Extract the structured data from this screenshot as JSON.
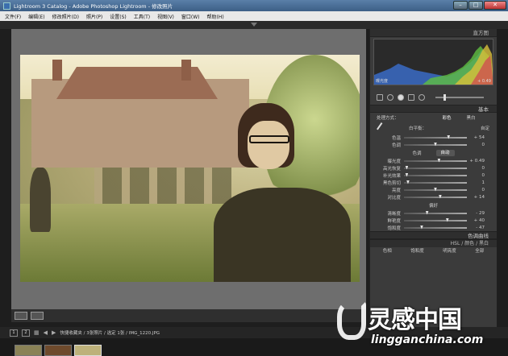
{
  "window": {
    "title": "Lightroom 3 Catalog - Adobe Photoshop Lightroom - 修改照片"
  },
  "menu": [
    "文件(F)",
    "编辑(E)",
    "修改照片(D)",
    "照片(P)",
    "设置(S)",
    "工具(T)",
    "视图(V)",
    "窗口(W)",
    "帮助(H)"
  ],
  "panels": {
    "histogram_title": "直方图",
    "histogram_label": "曝光度",
    "histogram_value": "+ 0.49",
    "basic_title": "基本",
    "treatment_label": "处理方式：",
    "treatment_options": [
      "彩色",
      "黑白"
    ],
    "wb_label": "白平衡：",
    "wb_value": "自定",
    "temp": {
      "name": "色温",
      "value": "+ 54",
      "pos": 0.72
    },
    "tint": {
      "name": "色调",
      "value": "0",
      "pos": 0.5
    },
    "tone_label": "色调",
    "auto_label": "自动",
    "tone_sliders": [
      {
        "name": "曝光度",
        "value": "+ 0.49",
        "pos": 0.56
      },
      {
        "name": "高光恢复",
        "value": "0",
        "pos": 0.02
      },
      {
        "name": "补光效果",
        "value": "0",
        "pos": 0.02
      },
      {
        "name": "黑色剪切",
        "value": "1",
        "pos": 0.04
      },
      {
        "name": "亮度",
        "value": "0",
        "pos": 0.5
      },
      {
        "name": "对比度",
        "value": "+ 14",
        "pos": 0.58
      }
    ],
    "presence_label": "偏好",
    "presence_sliders": [
      {
        "name": "清晰度",
        "value": "- 29",
        "pos": 0.36
      },
      {
        "name": "鲜艳度",
        "value": "+ 40",
        "pos": 0.7
      },
      {
        "name": "饱和度",
        "value": "- 47",
        "pos": 0.27
      }
    ],
    "tone_curve_title": "色调曲线",
    "hsl_title": "HSL / 颜色 / 黑白",
    "hsl_tabs": [
      "色相",
      "饱和度",
      "明亮度",
      "全部"
    ]
  },
  "filmstrip": {
    "page_boxes": [
      "1",
      "2"
    ],
    "path": "快捷收藏夹 / 3张照片 / 选定 1张 / IMG_1220.JPG"
  },
  "watermark": {
    "cn": "灵感中国",
    "en": "lingganchina.com"
  }
}
